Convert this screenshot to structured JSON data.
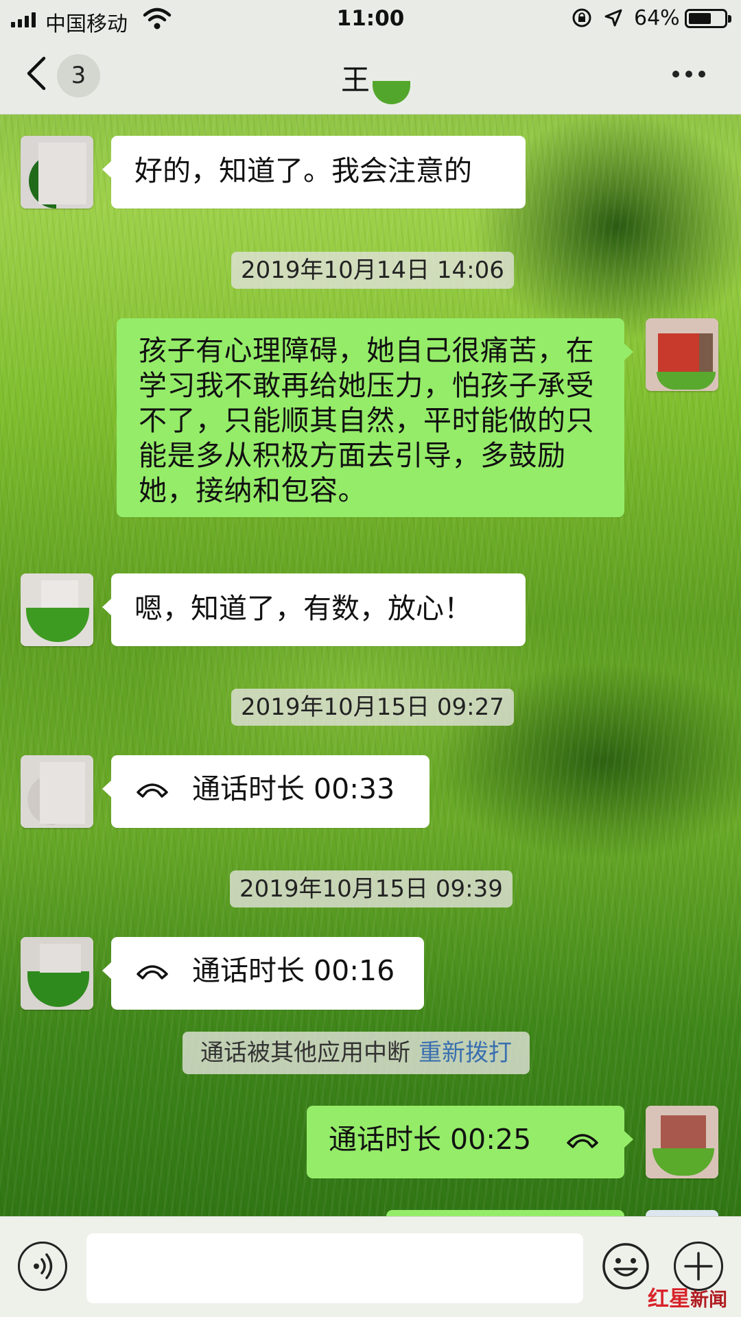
{
  "status_bar": {
    "carrier": "中国移动",
    "time": "11:00",
    "battery_percent": "64%",
    "battery_level": 0.64
  },
  "nav": {
    "unread_count": "3",
    "contact_name": "王"
  },
  "messages": [
    {
      "type": "text",
      "direction": "incoming",
      "text": "好的，知道了。我会注意的"
    },
    {
      "type": "timestamp",
      "text": "2019年10月14日 14:06"
    },
    {
      "type": "text",
      "direction": "outgoing",
      "text": "孩子有心理障碍，她自己很痛苦，在学习我不敢再给她压力，怕孩子承受不了，只能顺其自然，平时能做的只能是多从积极方面去引导，多鼓励她，接纳和包容。"
    },
    {
      "type": "text",
      "direction": "incoming",
      "text": "嗯，知道了，有数，放心！"
    },
    {
      "type": "timestamp",
      "text": "2019年10月15日 09:27"
    },
    {
      "type": "call",
      "direction": "incoming",
      "text": "通话时长 00:33"
    },
    {
      "type": "timestamp",
      "text": "2019年10月15日 09:39"
    },
    {
      "type": "call",
      "direction": "incoming",
      "text": "通话时长 00:16"
    },
    {
      "type": "system",
      "text": "通话被其他应用中断",
      "link": "重新拨打"
    },
    {
      "type": "call",
      "direction": "outgoing",
      "text": "通话时长 00:25"
    }
  ],
  "watermark": {
    "red": "红星",
    "dark": "新闻"
  },
  "icons": {
    "back": "chevron-left-icon",
    "more": "more-dots-icon",
    "call": "phone-hangup-icon",
    "voice": "voice-icon",
    "emoji": "emoji-icon",
    "plus": "plus-icon"
  },
  "colors": {
    "incoming_bubble": "#ffffff",
    "outgoing_bubble": "#95ec69",
    "link": "#3a6fb0",
    "watermark_red": "#d8232a"
  }
}
